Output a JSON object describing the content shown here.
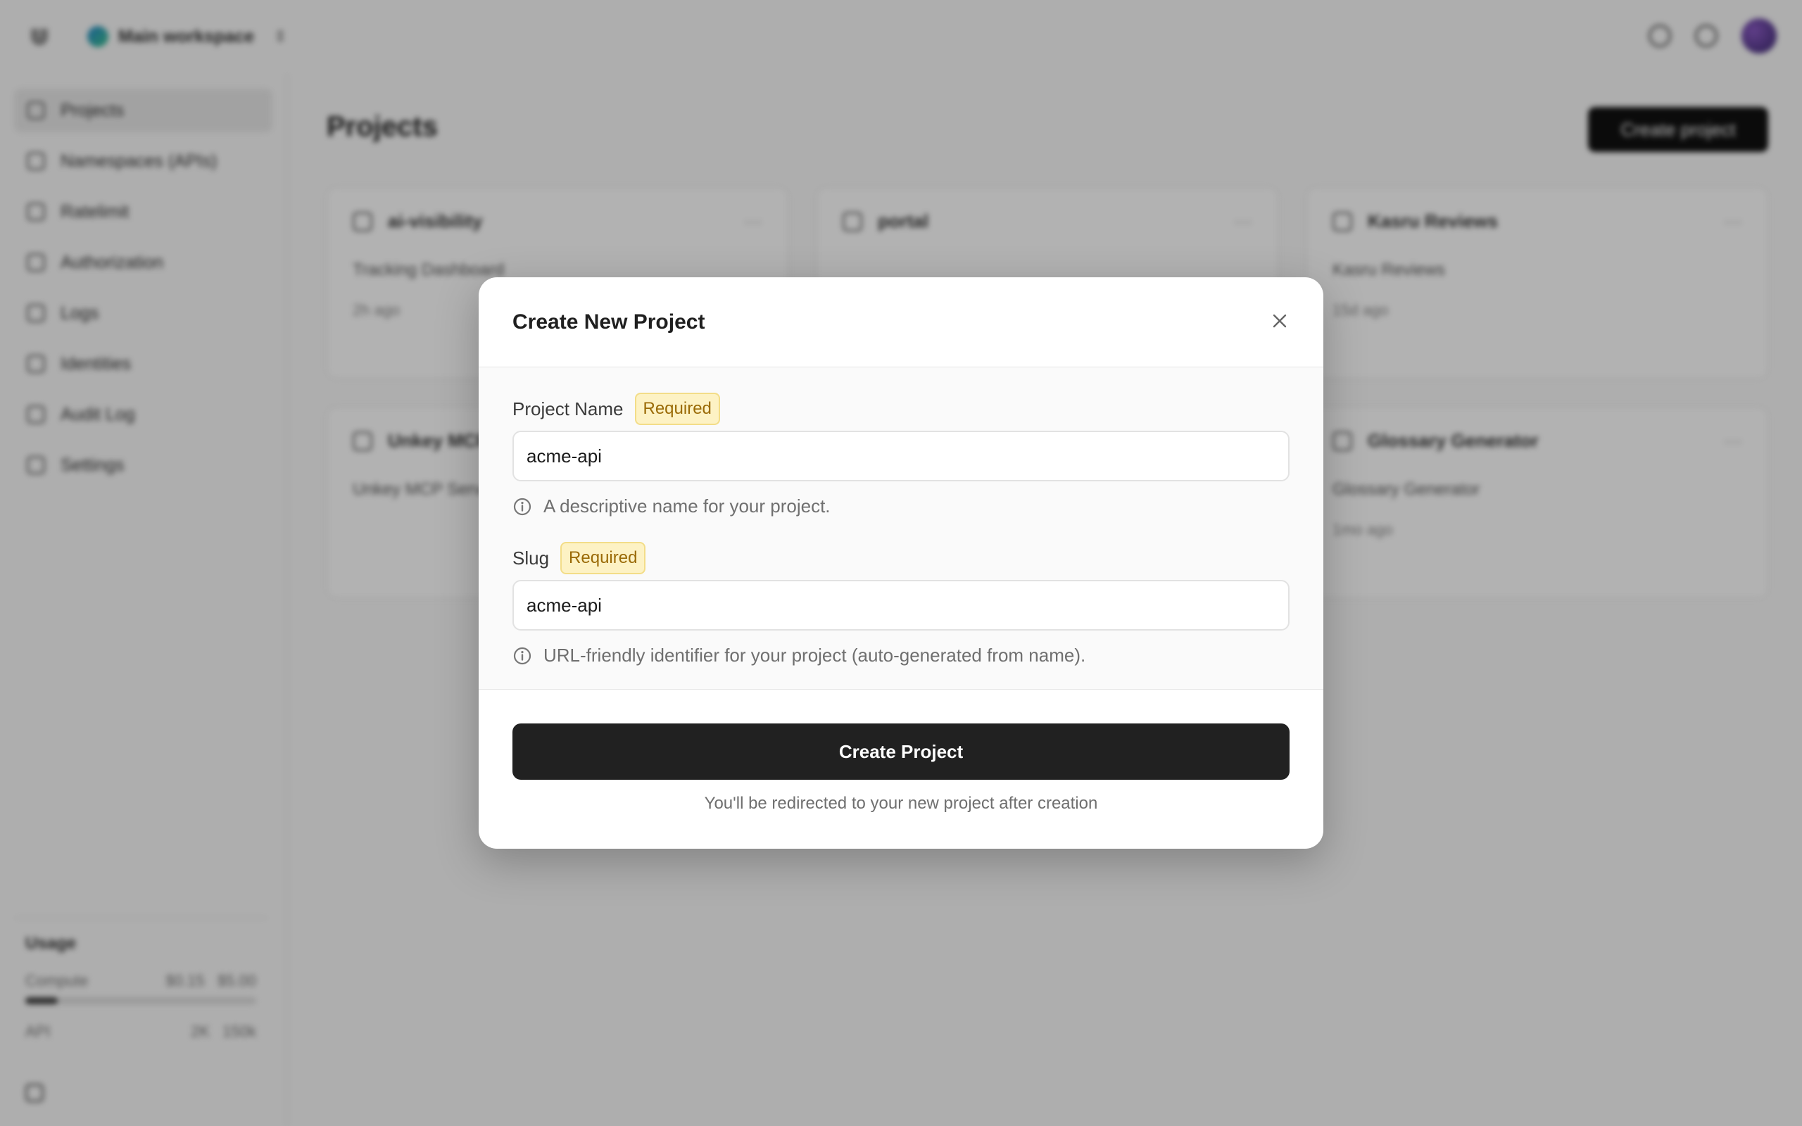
{
  "topbar": {
    "workspace_name": "Main workspace"
  },
  "sidebar": {
    "items": [
      {
        "label": "Projects"
      },
      {
        "label": "Namespaces (APIs)"
      },
      {
        "label": "Ratelimit"
      },
      {
        "label": "Authorization"
      },
      {
        "label": "Logs"
      },
      {
        "label": "Identities"
      },
      {
        "label": "Audit Log"
      },
      {
        "label": "Settings"
      }
    ],
    "usage": {
      "title": "Usage",
      "rows": [
        {
          "label": "Compute",
          "value": "$0.15",
          "limit": "$5.00"
        },
        {
          "label": "API",
          "value": "2K",
          "limit": "150k"
        }
      ]
    }
  },
  "main": {
    "title": "Projects",
    "create_button": "Create project",
    "cards": [
      {
        "name": "ai-visibility",
        "desc": "Tracking Dashboard",
        "meta": "2h ago"
      },
      {
        "name": "portal",
        "desc": "",
        "meta": ""
      },
      {
        "name": "Kasru Reviews",
        "desc": "Kasru Reviews",
        "meta": "15d ago"
      },
      {
        "name": "Unkey MCP Server",
        "desc": "Unkey MCP Server",
        "meta": ""
      },
      {
        "name": "",
        "desc": "",
        "meta": ""
      },
      {
        "name": "Glossary Generator",
        "desc": "Glossary Generator",
        "meta": "1mo ago"
      }
    ]
  },
  "modal": {
    "title": "Create New Project",
    "name_field": {
      "label": "Project Name",
      "badge": "Required",
      "value": "acme-api",
      "hint": "A descriptive name for your project."
    },
    "slug_field": {
      "label": "Slug",
      "badge": "Required",
      "value": "acme-api",
      "hint": "URL-friendly identifier for your project (auto-generated from name)."
    },
    "submit_label": "Create Project",
    "footer_note": "You'll be redirected to your new project after creation"
  }
}
